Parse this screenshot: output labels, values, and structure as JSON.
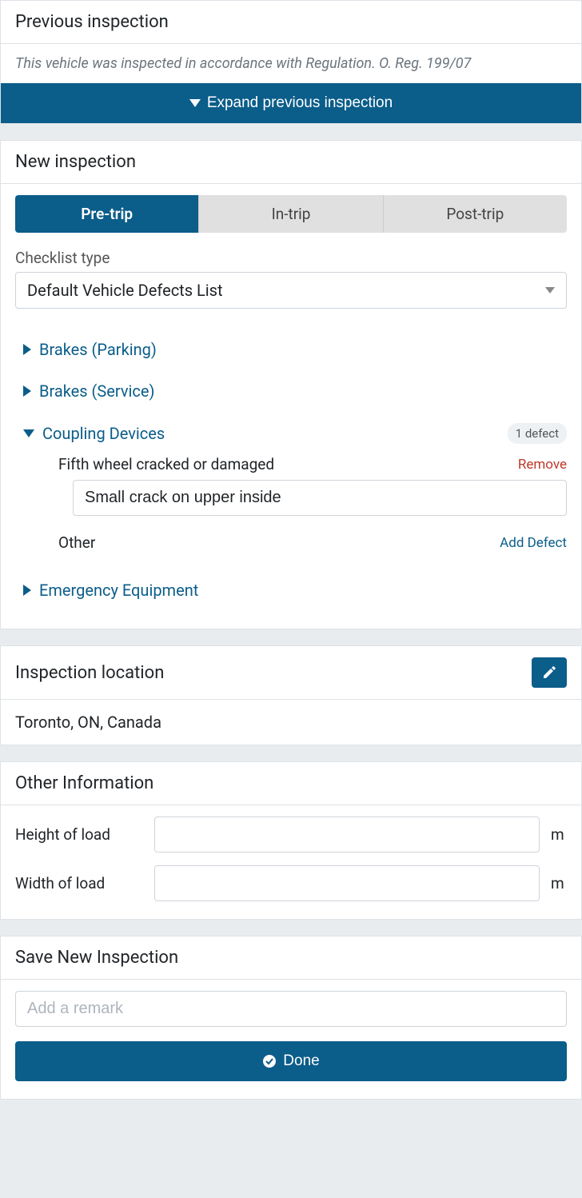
{
  "previous": {
    "title": "Previous inspection",
    "note": "This vehicle was inspected in accordance with Regulation. O. Reg. 199/07",
    "expand_label": "Expand previous inspection"
  },
  "new": {
    "title": "New inspection",
    "tabs": [
      "Pre-trip",
      "In-trip",
      "Post-trip"
    ],
    "active_tab": 0,
    "checklist_type_label": "Checklist type",
    "checklist_type_value": "Default Vehicle Defects List",
    "items": [
      {
        "label": "Brakes (Parking)",
        "expanded": false
      },
      {
        "label": "Brakes (Service)",
        "expanded": false
      },
      {
        "label": "Coupling Devices",
        "expanded": true,
        "badge": "1 defect",
        "defects": [
          {
            "title": "Fifth wheel cracked or damaged",
            "note": "Small crack on upper inside",
            "remove": "Remove"
          }
        ],
        "other_label": "Other",
        "add_label": "Add Defect"
      },
      {
        "label": "Emergency Equipment",
        "expanded": false
      }
    ]
  },
  "location": {
    "title": "Inspection location",
    "value": "Toronto, ON, Canada"
  },
  "other_info": {
    "title": "Other Information",
    "height_label": "Height of load",
    "height_unit": "m",
    "width_label": "Width of load",
    "width_unit": "m"
  },
  "save": {
    "title": "Save New Inspection",
    "remark_placeholder": "Add a remark",
    "done_label": "Done"
  }
}
